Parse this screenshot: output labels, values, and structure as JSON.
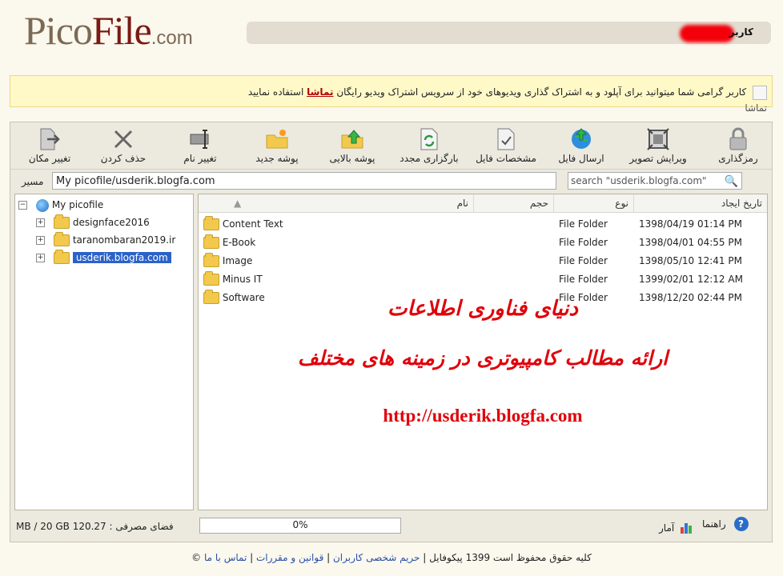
{
  "brand": {
    "logo_a": "Pico",
    "logo_b": "File",
    "logo_c": ".com"
  },
  "user": {
    "label": "کاربر"
  },
  "notice": {
    "text": "کاربر گرامی شما میتوانید برای آپلود و به اشتراک گذاری ویدیوهای خود از سرویس اشتراک ویدیو رایگان",
    "link": "تماشا",
    "after": "استفاده نمایید",
    "line2": "تماشا"
  },
  "toolbar": {
    "lock": "رمزگذاری",
    "edit_image": "ویرایش تصویر",
    "send_file": "ارسال فایل",
    "file_props": "مشخصات فایل",
    "reload": "بارگزاری مجدد",
    "folder_up": "پوشه بالایی",
    "new_folder": "پوشه جدید",
    "rename": "تغییر نام",
    "delete": "حذف کردن",
    "move": "تغییر مکان"
  },
  "path": {
    "label": "مسیر",
    "value": "My picofile/usderik.blogfa.com"
  },
  "search": {
    "placeholder": "search \"usderik.blogfa.com\""
  },
  "tree": {
    "root": "My picofile",
    "items": [
      "designface2016",
      "taranombaran2019.ir",
      "usderik.blogfa.com"
    ]
  },
  "columns": {
    "name": "نام",
    "size": "حجم",
    "type": "نوع",
    "date": "تاریخ ایجاد"
  },
  "files": [
    {
      "name": "Content Text",
      "type": "File Folder",
      "date": "1398/04/19 01:14 PM"
    },
    {
      "name": "E-Book",
      "type": "File Folder",
      "date": "1398/04/01 04:55 PM"
    },
    {
      "name": "Image",
      "type": "File Folder",
      "date": "1398/05/10 12:41 PM"
    },
    {
      "name": "Minus IT",
      "type": "File Folder",
      "date": "1399/02/01 12:12 AM"
    },
    {
      "name": "Software",
      "type": "File Folder",
      "date": "1398/12/20 02:44 PM"
    }
  ],
  "watermark": {
    "line1": "دنیای فناوری اطلاعات",
    "line2": "ارائه مطالب کامپیوتری در زمینه های مختلف",
    "line3": "http://usderik.blogfa.com"
  },
  "status": {
    "space_label": "فضای مصرفی :",
    "space_value": "120.27 MB / 20 GB",
    "progress_text": "0%",
    "progress_value": 0.0,
    "stats": "آمار",
    "help": "راهنما"
  },
  "footer": {
    "copyright": "کلیه حقوق محفوظ است 1399 پیکوفایل",
    "privacy": "حریم شخصی کاربران",
    "rules": "قوانین و مقررات",
    "contact": "تماس با ما",
    "copy_sym": "©"
  },
  "colors": {
    "accent": "#2b62c9",
    "watermark": "#e0000a",
    "notice_bg": "#fff9c8"
  }
}
